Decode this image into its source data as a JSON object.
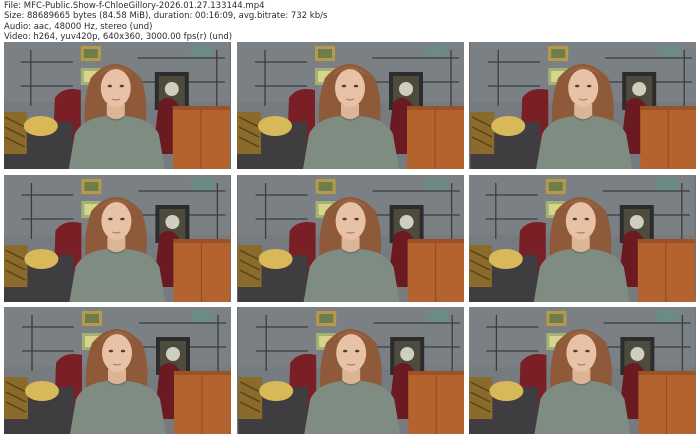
{
  "info": {
    "file_line": "File: MFC-Public.Show-f-ChloeGillory-2026.01.27.133144.mp4",
    "size_line": "Size: 88689665 bytes (84.58 MiB), duration: 00:16:09, avg.bitrate: 732 kb/s",
    "audio_line": "Audio: aac, 48000 Hz, stereo (und)",
    "video_line": "Video: h264, yuv420p, 640x360, 3000.00 fps(r) (und)"
  },
  "thumbnails": [
    {
      "name": "frame-1"
    },
    {
      "name": "frame-2"
    },
    {
      "name": "frame-3"
    },
    {
      "name": "frame-4"
    },
    {
      "name": "frame-5"
    },
    {
      "name": "frame-6"
    },
    {
      "name": "frame-7"
    },
    {
      "name": "frame-8"
    },
    {
      "name": "frame-9"
    }
  ],
  "colors": {
    "wall": "#767b80",
    "sweater": "#7f8c82",
    "hair": "#8e5a3a",
    "skin": "#e7c2a6",
    "cabinet": "#b5632e",
    "pillow": "#d9b85a",
    "chair": "#7a1f26",
    "couch": "#3f3d3f"
  }
}
